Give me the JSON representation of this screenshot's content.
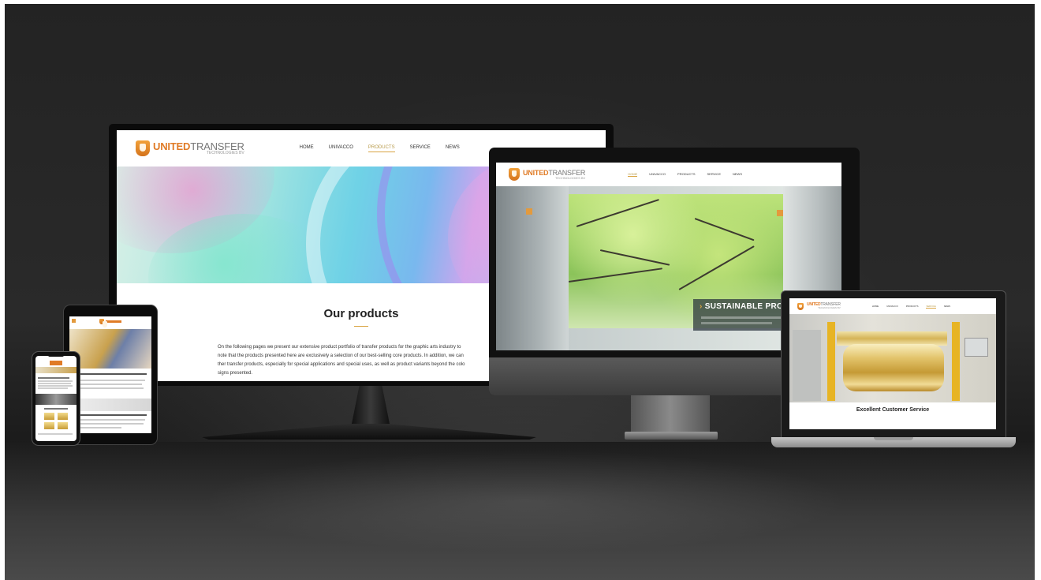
{
  "monitor_site": {
    "logo": {
      "name_part1": "UNITED",
      "name_part2": "TRANSFER",
      "subtitle": "TECHNOLOGIES BV"
    },
    "nav": [
      "HOME",
      "UNIVACCO",
      "PRODUCTS",
      "SERVICE",
      "NEWS"
    ],
    "active_nav": "PRODUCTS",
    "heading": "Our products",
    "body_lines": [
      "On the following pages we present our extensive product portfolio of transfer products for the graphic arts industry to",
      "note that the products presented here are exclusively a selection of our best-selling core products. In addition, we can",
      "ther transfer products, especially for special applications and special uses, as well as product variants beyond the colo",
      "signs presented."
    ]
  },
  "imac_site": {
    "logo": {
      "name_part1": "UNITED",
      "name_part2": "TRANSFER",
      "subtitle": "TECHNOLOGIES BV"
    },
    "nav": [
      "HOME",
      "UNIVACCO",
      "PRODUCTS",
      "SERVICE",
      "NEWS"
    ],
    "active_nav": "HOME",
    "banner_arrow": "›",
    "banner_title": "SUSTAINABLE PROD"
  },
  "laptop_site": {
    "logo": {
      "name_part1": "UNITED",
      "name_part2": "TRANSFER",
      "subtitle": "TECHNOLOGIES BV"
    },
    "nav": [
      "HOME",
      "UNIVACCO",
      "PRODUCTS",
      "SERVICE",
      "NEWS"
    ],
    "active_nav": "SERVICE",
    "caption": "Excellent Customer Service"
  },
  "colors": {
    "accent": "#d9a441",
    "brand_orange": "#e07b26",
    "background": "#232323"
  }
}
